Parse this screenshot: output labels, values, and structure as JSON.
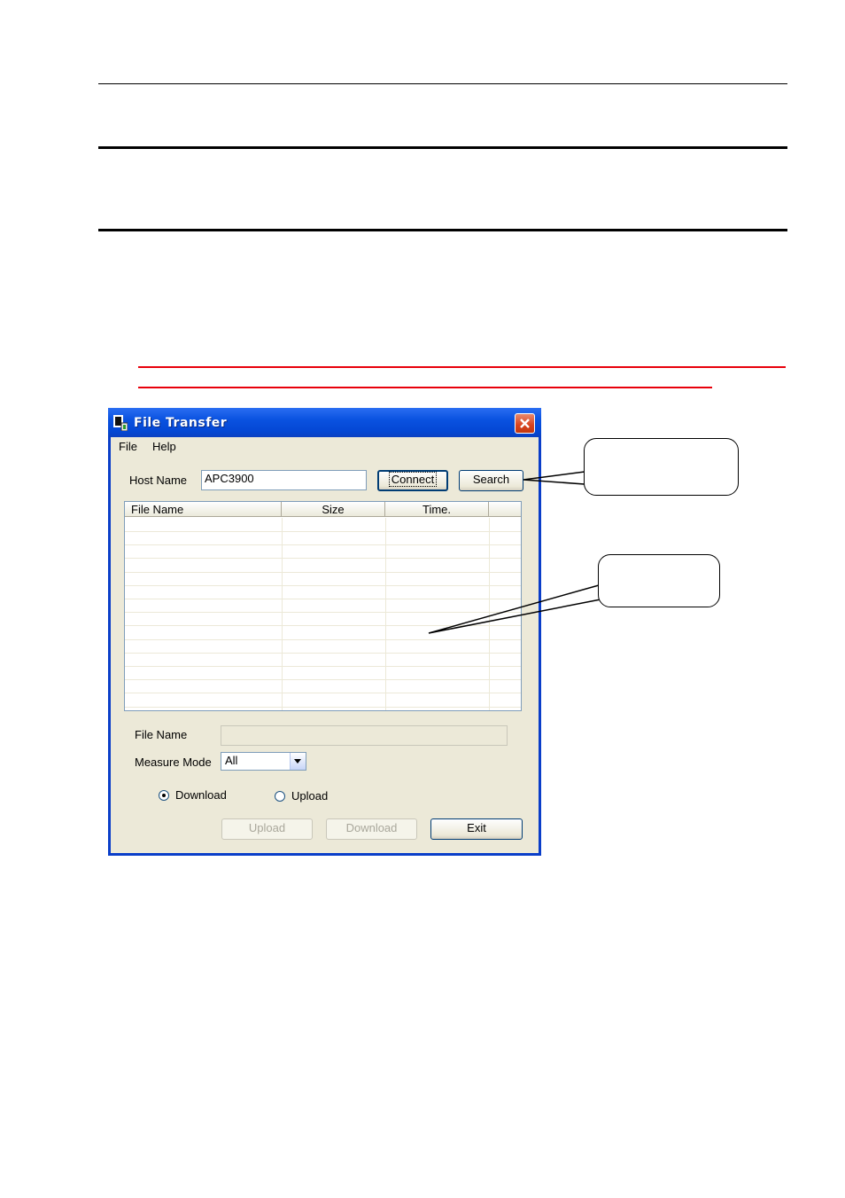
{
  "window": {
    "title": "File Transfer",
    "menu": [
      "File",
      "Help"
    ],
    "host_label": "Host Name",
    "host_value": "APC3900",
    "connect_label": "Connect",
    "search_label": "Search",
    "columns": [
      "File Name",
      "Size",
      "Time."
    ],
    "filename_label": "File Name",
    "filename_value": "",
    "mode_label": "Measure Mode",
    "mode_value": "All",
    "radio_download": "Download",
    "radio_upload": "Upload",
    "upload_button": "Upload",
    "download_button": "Download",
    "exit_button": "Exit",
    "selected_direction": "Download"
  },
  "colors": {
    "accent_red": "#e8000b",
    "titlebar_blue": "#0a52e0",
    "window_face": "#ece9d8"
  }
}
